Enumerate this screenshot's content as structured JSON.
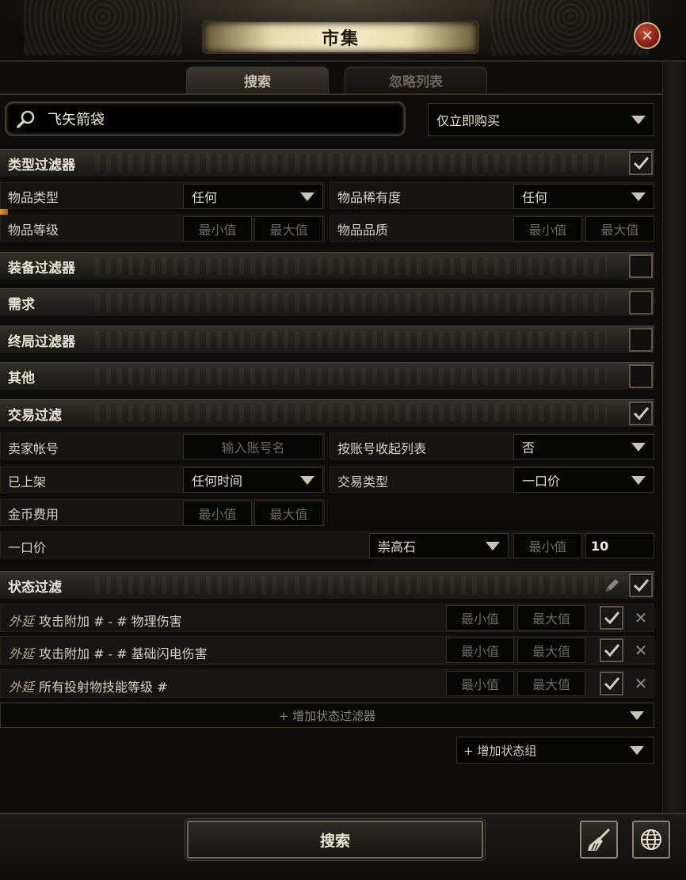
{
  "window": {
    "title": "市集",
    "close_icon": "close-icon"
  },
  "tabs": [
    {
      "label": "搜索",
      "active": true
    },
    {
      "label": "忽略列表",
      "active": false
    }
  ],
  "search": {
    "value": "飞矢箭袋",
    "icon": "search-icon"
  },
  "buy_filter": {
    "selected": "仅立即购买"
  },
  "type_filter": {
    "title": "类型过滤器",
    "checked": true,
    "item_type_label": "物品类型",
    "item_type_value": "任何",
    "rarity_label": "物品稀有度",
    "rarity_value": "任何",
    "item_level_label": "物品等级",
    "item_level_min": "最小值",
    "item_level_max": "最大值",
    "quality_label": "物品品质",
    "quality_min": "最小值",
    "quality_max": "最大值"
  },
  "collapsed_sections": [
    {
      "title": "装备过滤器",
      "checked": false
    },
    {
      "title": "需求",
      "checked": false
    },
    {
      "title": "终局过滤器",
      "checked": false
    },
    {
      "title": "其他",
      "checked": false
    }
  ],
  "trade_filter": {
    "title": "交易过滤",
    "checked": true,
    "seller_label": "卖家帐号",
    "seller_placeholder": "输入账号名",
    "collapse_label": "按账号收起列表",
    "collapse_value": "否",
    "listed_label": "已上架",
    "listed_value": "任何时间",
    "sale_type_label": "交易类型",
    "sale_type_value": "一口价",
    "gold_label": "金币费用",
    "gold_min": "最小值",
    "gold_max": "最大值",
    "price_label": "一口价",
    "price_currency": "崇高石",
    "price_min_placeholder": "最小值",
    "price_max_value": "10"
  },
  "stat_filter": {
    "title": "状态过滤",
    "checked": true,
    "rows": [
      {
        "affix": "外延",
        "text": "攻击附加 # - # 物理伤害",
        "min": "最小值",
        "max": "最大值",
        "checked": true
      },
      {
        "affix": "外延",
        "text": "攻击附加 # - # 基础闪电伤害",
        "min": "最小值",
        "max": "最大值",
        "checked": true
      },
      {
        "affix": "外延",
        "text": "所有投射物技能等级 #",
        "min": "最小值",
        "max": "最大值",
        "checked": true
      }
    ],
    "add_filter_label": "+ 增加状态过滤器",
    "add_group_label": "+ 增加状态组"
  },
  "footer": {
    "search_label": "搜索",
    "clear_icon": "broom-icon",
    "region_icon": "globe-icon"
  },
  "colors": {
    "panel": "#0e0d0c",
    "section": "#2c2823",
    "accent": "#e8dcae",
    "close": "#a8322a"
  }
}
